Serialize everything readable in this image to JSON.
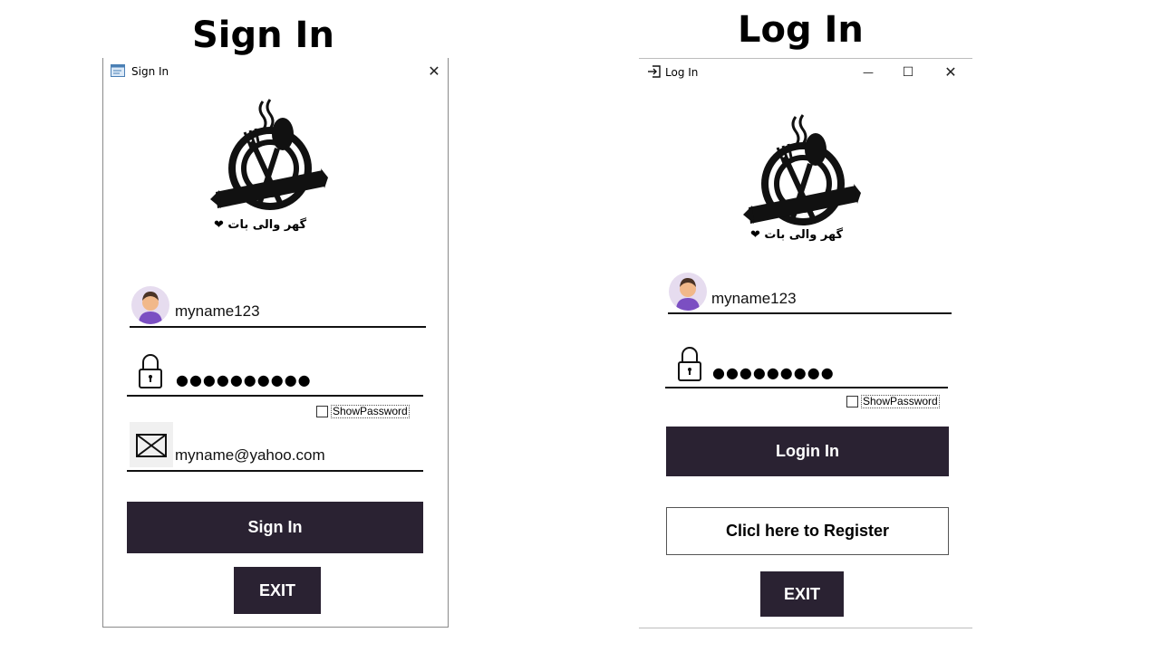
{
  "headings": {
    "signin": "Sign In",
    "login": "Log In"
  },
  "signin_window": {
    "title": "Sign In",
    "title_icon": "form-icon",
    "close_label": "✕",
    "logo_caption": "گھر والی بات ❤",
    "username": "myname123",
    "password_mask": "●●●●●●●●●●",
    "show_password_label": "ShowPassword",
    "email": "myname@yahoo.com",
    "signin_button": "Sign In",
    "exit_button": "EXIT"
  },
  "login_window": {
    "title": "Log In",
    "title_icon": "login-icon",
    "minimize_label": "—",
    "maximize_label": "☐",
    "close_label": "✕",
    "logo_caption": "گھر والی بات ❤",
    "username": "myname123",
    "password_mask": "●●●●●●●●●",
    "show_password_label": "ShowPassword",
    "login_button": "Login In",
    "register_button": "Clicl here to Register",
    "exit_button": "EXIT"
  },
  "colors": {
    "button_dark": "#2a2232",
    "avatar_bg": "#e6dcef"
  }
}
